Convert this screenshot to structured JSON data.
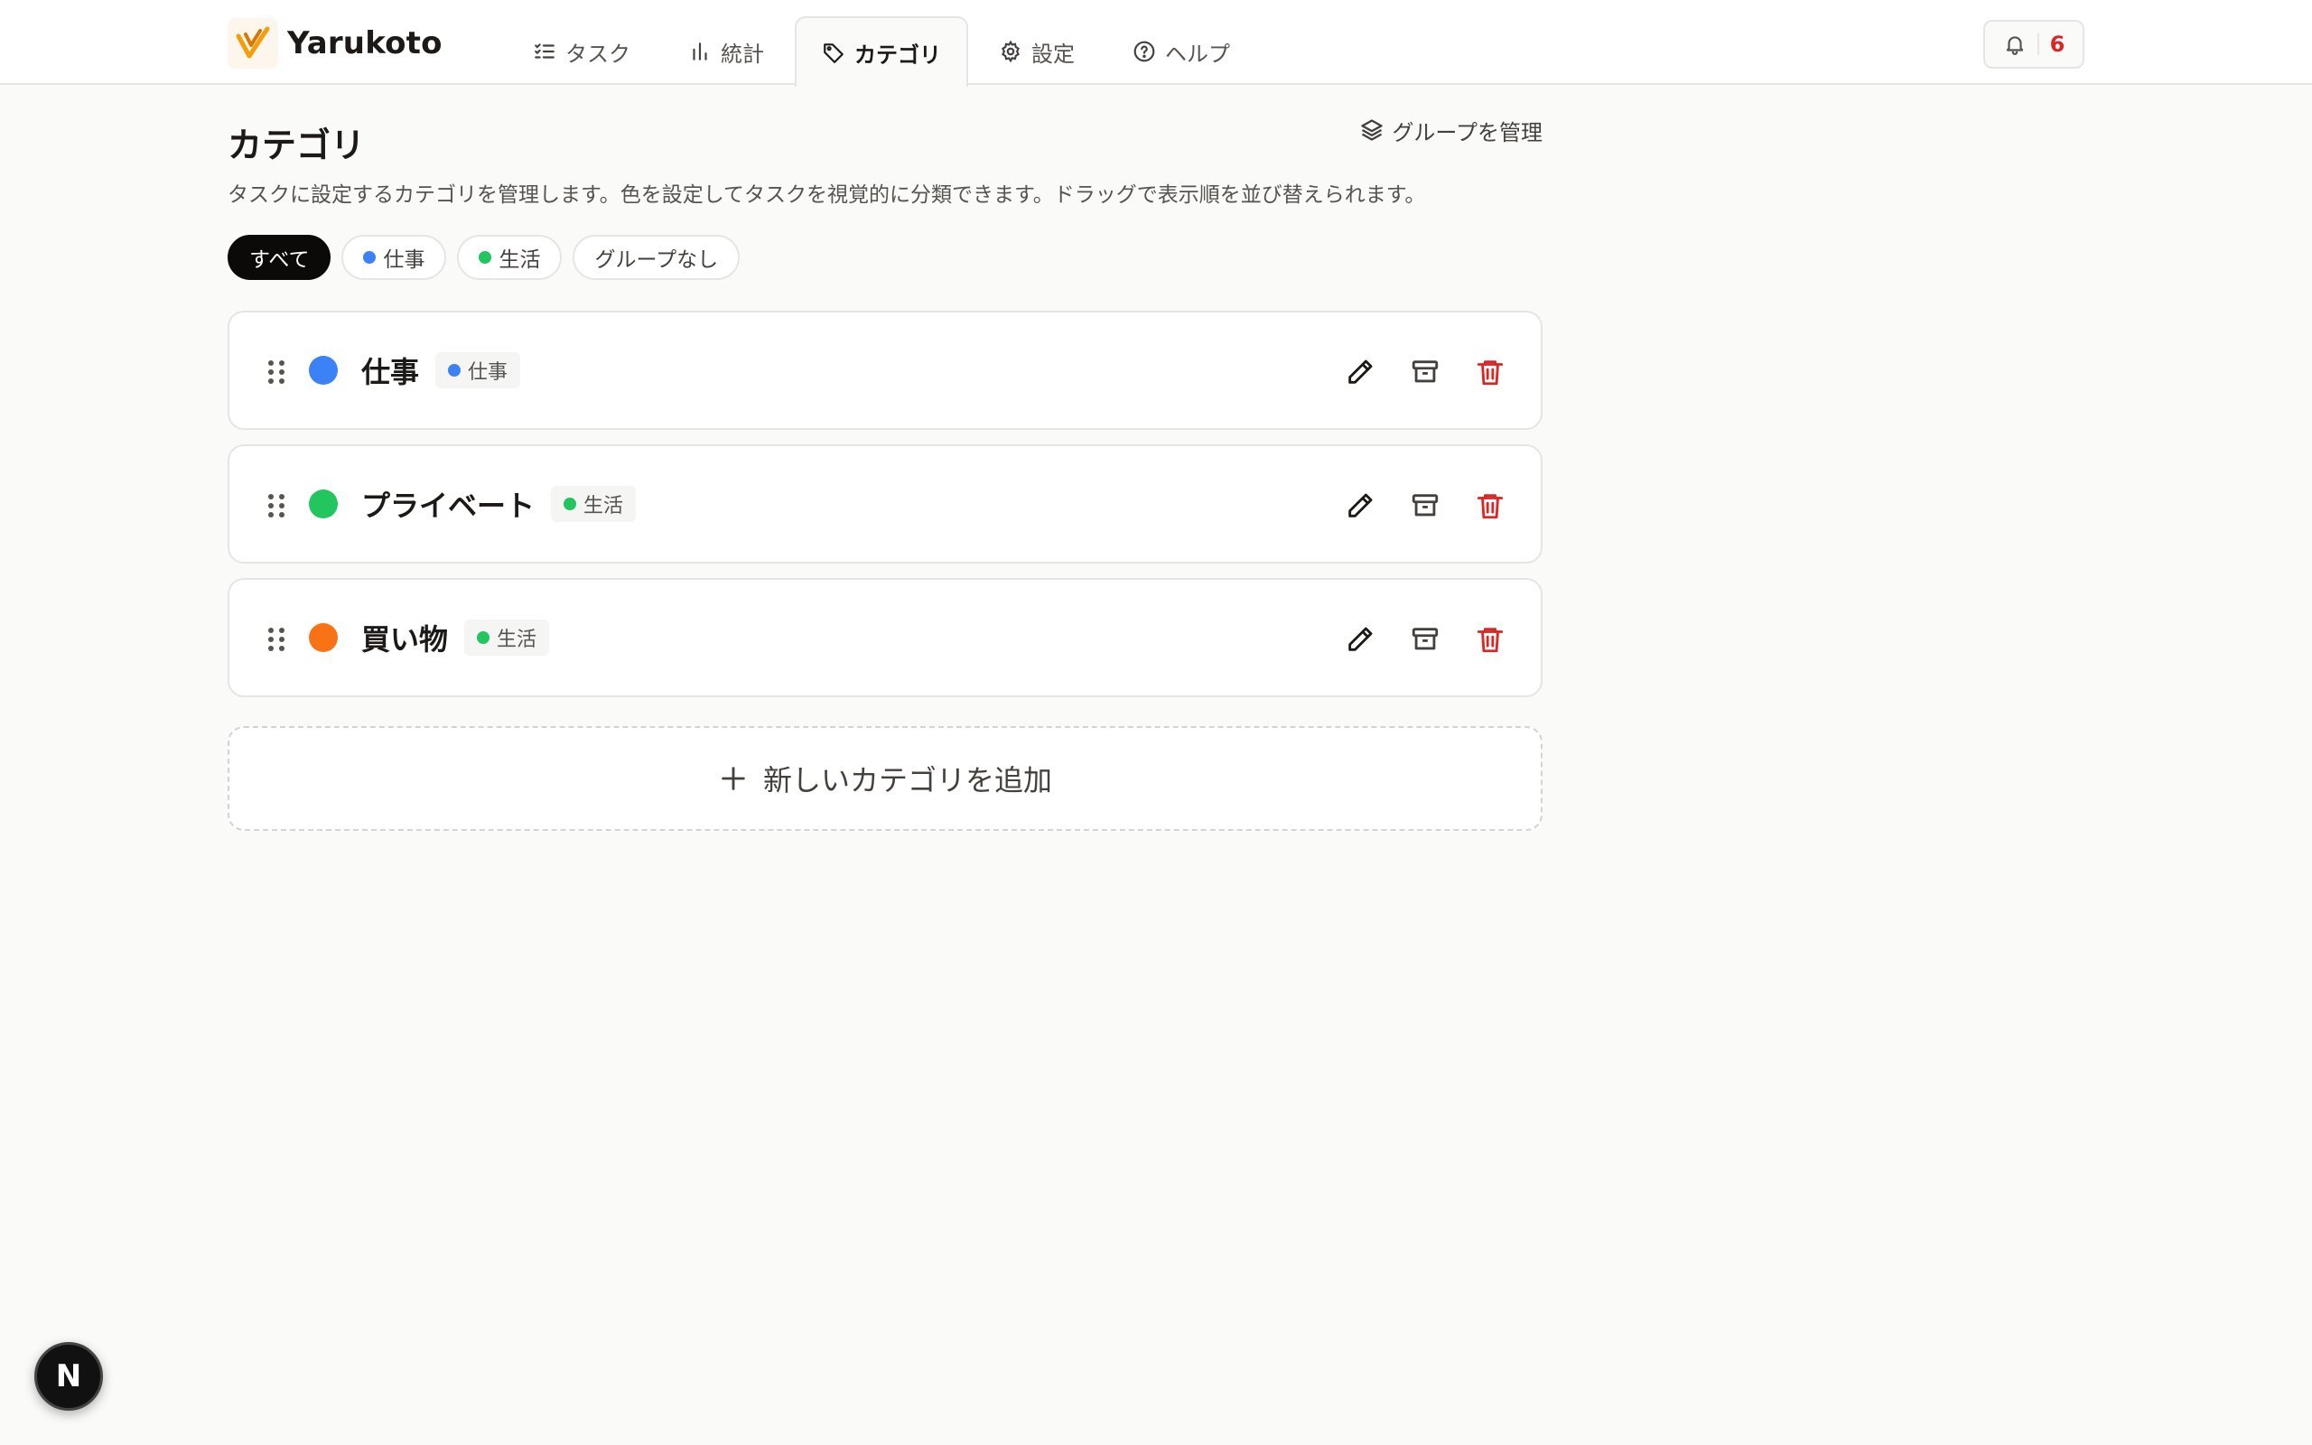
{
  "app": {
    "name": "Yarukoto"
  },
  "nav": {
    "tabs": [
      {
        "label": "タスク",
        "icon": "list-check-icon"
      },
      {
        "label": "統計",
        "icon": "bar-chart-icon"
      },
      {
        "label": "カテゴリ",
        "icon": "tag-icon",
        "active": true
      },
      {
        "label": "設定",
        "icon": "gear-icon"
      },
      {
        "label": "ヘルプ",
        "icon": "help-circle-icon"
      }
    ]
  },
  "notifications": {
    "count": "6",
    "icon": "bell-icon"
  },
  "page": {
    "title": "カテゴリ",
    "manage_groups_label": "グループを管理",
    "description": "タスクに設定するカテゴリを管理します。色を設定してタスクを視覚的に分類できます。ドラッグで表示順を並び替えられます。"
  },
  "filters": [
    {
      "label": "すべて",
      "active": true
    },
    {
      "label": "仕事",
      "color": "#3b82f6"
    },
    {
      "label": "生活",
      "color": "#22c55e"
    },
    {
      "label": "グループなし"
    }
  ],
  "categories": [
    {
      "name": "仕事",
      "color": "#3b82f6",
      "group": "仕事",
      "group_color": "#3b82f6"
    },
    {
      "name": "プライベート",
      "color": "#22c55e",
      "group": "生活",
      "group_color": "#22c55e"
    },
    {
      "name": "買い物",
      "color": "#f97316",
      "group": "生活",
      "group_color": "#22c55e"
    }
  ],
  "add_category_label": "新しいカテゴリを追加",
  "colors": {
    "accent": "#0c0a09",
    "danger": "#dc2626",
    "logo": "#f59e0b"
  },
  "dev_badge": "N"
}
